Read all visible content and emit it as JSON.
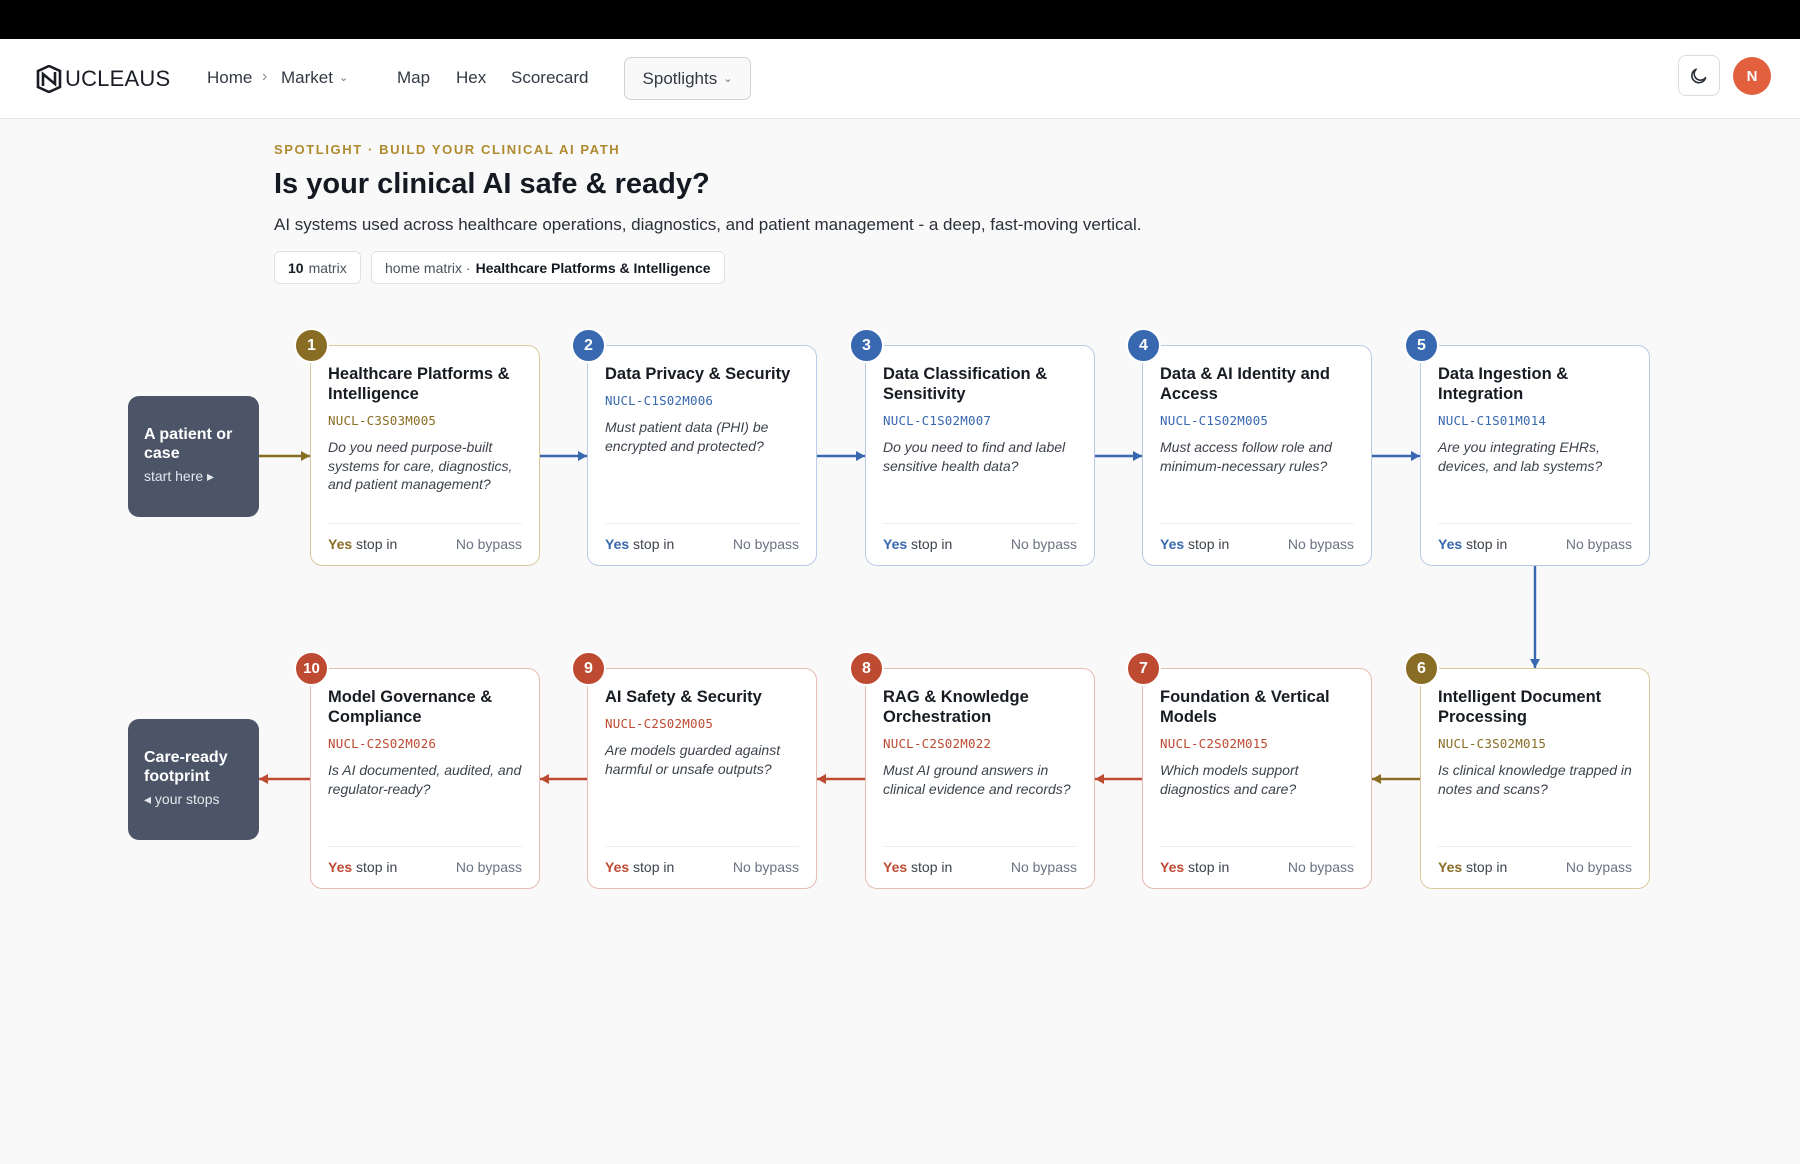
{
  "brand": {
    "logo_text": "UCLEAUS"
  },
  "nav": {
    "home": "Home",
    "market": "Market",
    "map": "Map",
    "hex": "Hex",
    "scorecard": "Scorecard",
    "spotlights": "Spotlights",
    "avatar_initial": "N"
  },
  "header": {
    "eyebrow": "SPOTLIGHT · BUILD YOUR CLINICAL AI PATH",
    "title": "Is your clinical AI safe & ready?",
    "subtitle": "AI systems used across healthcare operations, diagnostics, and patient management - a deep, fast-moving vertical.",
    "pill_count_num": "10",
    "pill_count_label": "matrix",
    "pill_home_label": "home matrix ·",
    "pill_home_value": "Healthcare Platforms & Intelligence"
  },
  "colors": {
    "gold": "#8a6d24",
    "blue": "#3868b0",
    "red": "#be4a32",
    "endpoint": "#4b5567"
  },
  "start": {
    "title": "A patient or case",
    "sub": "start here ▸"
  },
  "end": {
    "title": "Care-ready footprint",
    "sub": "◂ your stops"
  },
  "steps": [
    {
      "num": "1",
      "title": "Healthcare Platforms & Intelligence",
      "code": "NUCL-C3S03M005",
      "question": "Do you need purpose-built systems for care, diagnostics, and patient management?",
      "yes": "Yes",
      "stop": "stop in",
      "bypass": "No bypass",
      "color": "gold"
    },
    {
      "num": "2",
      "title": "Data Privacy & Security",
      "code": "NUCL-C1S02M006",
      "question": "Must patient data (PHI) be encrypted and protected?",
      "yes": "Yes",
      "stop": "stop in",
      "bypass": "No bypass",
      "color": "blue"
    },
    {
      "num": "3",
      "title": "Data Classification & Sensitivity",
      "code": "NUCL-C1S02M007",
      "question": "Do you need to find and label sensitive health data?",
      "yes": "Yes",
      "stop": "stop in",
      "bypass": "No bypass",
      "color": "blue"
    },
    {
      "num": "4",
      "title": "Data & AI Identity and Access",
      "code": "NUCL-C1S02M005",
      "question": "Must access follow role and minimum-necessary rules?",
      "yes": "Yes",
      "stop": "stop in",
      "bypass": "No bypass",
      "color": "blue"
    },
    {
      "num": "5",
      "title": "Data Ingestion & Integration",
      "code": "NUCL-C1S01M014",
      "question": "Are you integrating EHRs, devices, and lab systems?",
      "yes": "Yes",
      "stop": "stop in",
      "bypass": "No bypass",
      "color": "blue"
    },
    {
      "num": "6",
      "title": "Intelligent Document Processing",
      "code": "NUCL-C3S02M015",
      "question": "Is clinical knowledge trapped in notes and scans?",
      "yes": "Yes",
      "stop": "stop in",
      "bypass": "No bypass",
      "color": "gold"
    },
    {
      "num": "7",
      "title": "Foundation & Vertical Models",
      "code": "NUCL-C2S02M015",
      "question": "Which models support diagnostics and care?",
      "yes": "Yes",
      "stop": "stop in",
      "bypass": "No bypass",
      "color": "red"
    },
    {
      "num": "8",
      "title": "RAG & Knowledge Orchestration",
      "code": "NUCL-C2S02M022",
      "question": "Must AI ground answers in clinical evidence and records?",
      "yes": "Yes",
      "stop": "stop in",
      "bypass": "No bypass",
      "color": "red"
    },
    {
      "num": "9",
      "title": "AI Safety & Security",
      "code": "NUCL-C2S02M005",
      "question": "Are models guarded against harmful or unsafe outputs?",
      "yes": "Yes",
      "stop": "stop in",
      "bypass": "No bypass",
      "color": "red"
    },
    {
      "num": "10",
      "title": "Model Governance & Compliance",
      "code": "NUCL-C2S02M026",
      "question": "Is AI documented, audited, and regulator-ready?",
      "yes": "Yes",
      "stop": "stop in",
      "bypass": "No bypass",
      "color": "red"
    }
  ]
}
